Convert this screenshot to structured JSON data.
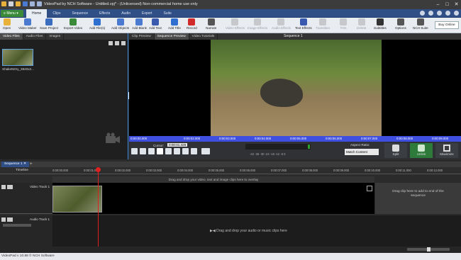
{
  "window": {
    "title": "VideoPad by NCH Software - Untitled.vpj* - (Unlicensed) Non-commercial home use only"
  },
  "menu": {
    "menu_label": "Menu",
    "tabs": [
      "Home",
      "Clips",
      "Sequence",
      "Effects",
      "Audio",
      "Export",
      "Suite"
    ],
    "active_tab": "Home"
  },
  "toolbar": {
    "items": [
      {
        "label": "Open",
        "icon": "folder-icon",
        "color": "#e8b13a",
        "enabled": true
      },
      {
        "label": "Video Maker",
        "icon": "video-maker-icon",
        "color": "#4a7bd0",
        "enabled": true
      },
      {
        "label": "Save Project",
        "icon": "save-icon",
        "color": "#3a6cc0",
        "enabled": true
      },
      {
        "label": "Export Video",
        "icon": "export-icon",
        "color": "#3a8a3a",
        "enabled": true
      },
      {
        "label": "Add File(s)",
        "icon": "add-file-icon",
        "color": "#2f6fd0",
        "enabled": true
      },
      {
        "label": "Add Objects",
        "icon": "add-objects-icon",
        "color": "#4a7bd0",
        "enabled": true
      },
      {
        "label": "Add Blank",
        "icon": "add-blank-icon",
        "color": "#4a7bd0",
        "enabled": true
      },
      {
        "label": "Add Text",
        "icon": "add-text-icon",
        "color": "#3a5ab0",
        "enabled": true
      },
      {
        "label": "Add Title",
        "icon": "add-title-icon",
        "color": "#2f6fd0",
        "enabled": true
      },
      {
        "label": "Record",
        "icon": "record-icon",
        "color": "#d02a2a",
        "enabled": true
      },
      {
        "label": "Narrate",
        "icon": "narrate-icon",
        "color": "#555555",
        "enabled": true
      },
      {
        "label": "Video Effects",
        "icon": "video-effects-icon",
        "color": "#888888",
        "enabled": false
      },
      {
        "label": "Image Effects",
        "icon": "image-effects-icon",
        "color": "#888888",
        "enabled": false
      },
      {
        "label": "Audio Effects",
        "icon": "audio-effects-icon",
        "color": "#888888",
        "enabled": false
      },
      {
        "label": "Text Effects",
        "icon": "text-effects-icon",
        "color": "#3a5ab0",
        "enabled": true
      },
      {
        "label": "Transition",
        "icon": "transition-icon",
        "color": "#888888",
        "enabled": false
      },
      {
        "label": "Trim",
        "icon": "trim-icon",
        "color": "#888888",
        "enabled": false
      },
      {
        "label": "Delete",
        "icon": "delete-icon",
        "color": "#888888",
        "enabled": false
      },
      {
        "label": "Subtitles",
        "icon": "subtitles-icon",
        "color": "#333333",
        "enabled": true
      },
      {
        "label": "Options",
        "icon": "options-icon",
        "color": "#555555",
        "enabled": true
      },
      {
        "label": "NCH Suite",
        "icon": "nch-suite-icon",
        "color": "#555555",
        "enabled": true
      }
    ],
    "buy_label": "Buy Online"
  },
  "bins": {
    "tabs": [
      "Video Files",
      "Audio Files",
      "Images"
    ],
    "active_tab": "Video Files",
    "file_name": "ShakeNDry_3840x2..."
  },
  "preview": {
    "tabs": [
      "Clip Preview",
      "Sequence Preview",
      "Video Tutorials"
    ],
    "active_tab": "Sequence Preview",
    "sequence_label": "Sequence 1",
    "ruler_times": [
      "0:00:00.000",
      "0:00:02.000",
      "0:00:03.000",
      "0:00:04.000",
      "0:00:05.000",
      "0:00:06.000",
      "0:00:07.000",
      "0:00:08.000",
      "0:00:09.000"
    ],
    "cursor_label": "Cursor:",
    "cursor_value": "0:00:01.426",
    "meter_scale": "-42  -36  -30  -24  -18  -12  -6  0",
    "aspect_label": "Aspect Ratio:",
    "aspect_value": "Match Content",
    "split_label": "Split",
    "unlink_label": "Unlink",
    "maximize_label": "Maximize"
  },
  "sequence": {
    "tab_label": "Sequence 1",
    "timeline_label": "Timeline",
    "timeline_marks": [
      "0:00:00.000",
      "0:00:01.000",
      "0:00:02.000",
      "0:00:03.000",
      "0:00:04.000",
      "0:00:05.000",
      "0:00:06.000",
      "0:00:07.000",
      "0:00:08.000",
      "0:00:09.000",
      "0:00:10.000",
      "0:00:11.000",
      "0:00:12.000"
    ],
    "overlay_hint": "Drag and drop your video, text and image clips here to overlay",
    "video_track_label": "Video Track 1",
    "audio_track_label": "Audio Track 1",
    "drop_end_hint": "Drag clip here to add to end of the sequence",
    "audio_hint": "Drag and drop your audio or music clips here"
  },
  "status": {
    "text": "VideoPad v 10.88 © NCH Software"
  }
}
